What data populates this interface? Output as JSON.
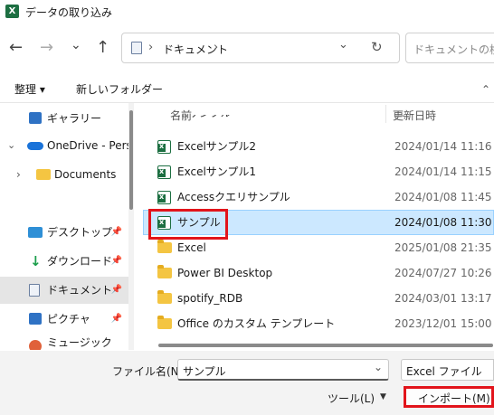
{
  "window": {
    "title": "データの取り込み",
    "app_icon": "excel-icon"
  },
  "nav": {
    "back": "←",
    "forward": "→",
    "recent": "⌄",
    "up": "↑",
    "breadcrumb_sep1": "›",
    "breadcrumb_item": "ドキュメント",
    "breadcrumb_sep2": "›",
    "dropdown": "⌄",
    "refresh": "↻",
    "search_placeholder": "ドキュメントの検索"
  },
  "cmdbar": {
    "organize": "整理 ▾",
    "new_folder": "新しいフォルダー",
    "more": "⌃"
  },
  "sidebar": {
    "items": [
      {
        "label": "ギャラリー",
        "icon": "gallery-icon"
      },
      {
        "label": "OneDrive - Perso",
        "icon": "cloud-icon",
        "chevron": "⌄"
      },
      {
        "label": "Documents",
        "icon": "folder-icon",
        "chevron": "›"
      },
      {
        "label": "デスクトップ",
        "icon": "desktop-icon"
      },
      {
        "label": "ダウンロード",
        "icon": "download-icon"
      },
      {
        "label": "ドキュメント",
        "icon": "document-icon"
      },
      {
        "label": "ピクチャ",
        "icon": "picture-icon"
      },
      {
        "label": "ミュージック",
        "icon": "music-icon"
      }
    ],
    "pin": "📌"
  },
  "list": {
    "columns": {
      "name": "名前",
      "modified": "更新日時",
      "up_arrow": "⌃"
    },
    "cut_row": {
      "name": "…サンプル",
      "date": "…"
    },
    "rows": [
      {
        "name": "Excelサンプル2",
        "date": "2024/01/14 11:16",
        "type": "excel"
      },
      {
        "name": "Excelサンプル1",
        "date": "2024/01/14 11:15",
        "type": "excel"
      },
      {
        "name": "Accessクエリサンプル",
        "date": "2024/01/08 11:45",
        "type": "excel"
      },
      {
        "name": "サンプル",
        "date": "2024/01/08 11:30",
        "type": "excel",
        "selected": true
      },
      {
        "name": "Excel",
        "date": "2025/01/08 21:35",
        "type": "folder"
      },
      {
        "name": "Power BI Desktop",
        "date": "2024/07/27 10:26",
        "type": "folder"
      },
      {
        "name": "spotify_RDB",
        "date": "2024/03/01 13:17",
        "type": "folder"
      },
      {
        "name": "Office のカスタム テンプレート",
        "date": "2023/12/01 15:00",
        "type": "folder"
      }
    ]
  },
  "footer": {
    "filename_label": "ファイル名(N):",
    "filename_value": "サンプル",
    "filetype_value": "Excel ファイル",
    "tools_label": "ツール(L)",
    "tools_caret": "▼",
    "import_label": "インポート(M)",
    "dropdown": "⌄"
  },
  "colors": {
    "accent_selection": "#cce8ff",
    "highlight_red": "#e2141b",
    "excel_green": "#1d6f42",
    "folder_yellow": "#f4c542"
  }
}
